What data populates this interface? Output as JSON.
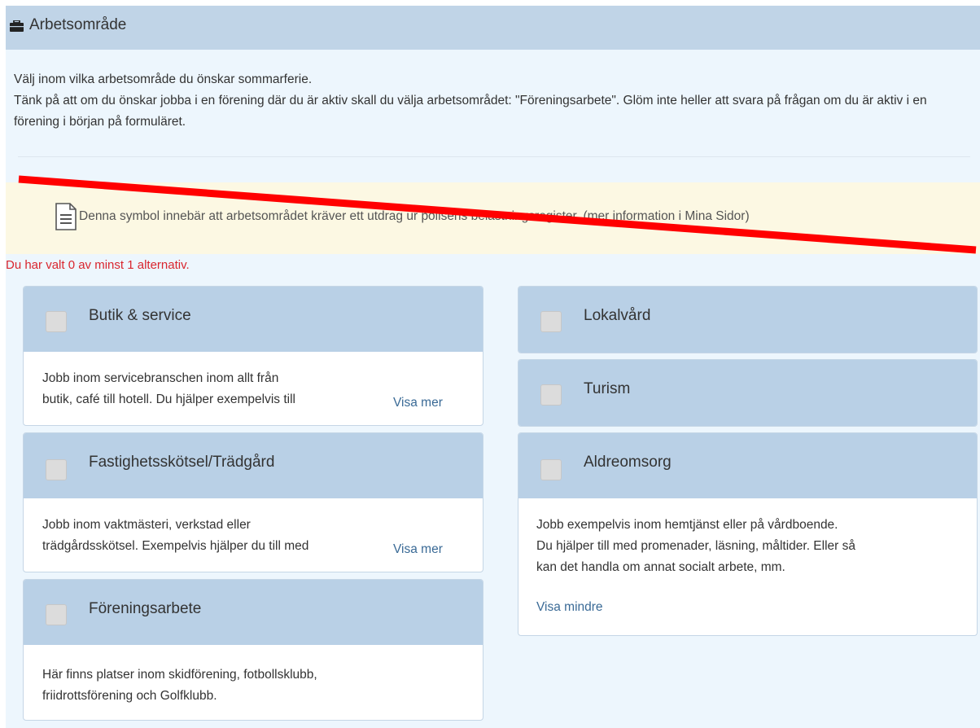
{
  "header": {
    "icon": "briefcase-icon",
    "title": "Arbetsområde"
  },
  "intro": {
    "line1": "Välj inom vilka arbetsområde du önskar sommarferie.",
    "line2": "Tänk på att om du önskar jobba i en förening där du är aktiv skall du välja arbetsområdet: \"Föreningsarbete\". Glöm inte heller att svara på frågan om du är aktiv i en förening i början på formuläret."
  },
  "notice": {
    "icon": "document-icon",
    "text": "Denna symbol innebär att arbetsområdet kräver ett utdrag ur polisens belastningsregister. (mer information i Mina Sidor)"
  },
  "selection_status": "Du har valt 0 av minst 1 alternativ.",
  "cards": {
    "butik": {
      "title": "Butik & service",
      "line1": "Jobb inom servicebranschen inom allt från",
      "line2": "butik, café till hotell. Du hjälper exempelvis till",
      "link": "Visa mer"
    },
    "fastighet": {
      "title": "Fastighetsskötsel/Trädgård",
      "line1": "Jobb inom vaktmästeri, verkstad eller",
      "line2": "trädgårdsskötsel. Exempelvis hjälper du till med",
      "link": "Visa mer"
    },
    "forening": {
      "title": "Föreningsarbete",
      "line1": "Här finns platser inom skidförening, fotbollsklubb,",
      "line2": "friidrottsförening och Golfklubb."
    },
    "lokalvard": {
      "title": "Lokalvård"
    },
    "turism": {
      "title": "Turism"
    },
    "aldreomsorg": {
      "title": "Aldreomsorg",
      "line1": "Jobb exempelvis inom hemtjänst eller på vårdboende.",
      "line2": "Du hjälper till med promenader, läsning, måltider. Eller så",
      "line3": "kan det handla om annat socialt arbete, mm.",
      "link": "Visa mindre"
    }
  },
  "colors": {
    "header_bg": "#c0d4e7",
    "panel_bg": "#edf6fd",
    "warning_bg": "#fcf8e3",
    "error_text": "#d9262e",
    "link": "#3a6a96",
    "strike_line": "#ff0000"
  }
}
